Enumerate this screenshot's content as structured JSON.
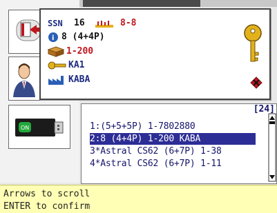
{
  "popup": {
    "type_label": "SSN",
    "count": "16",
    "range_top": "8-8",
    "info_text": "8 (4+4P)",
    "book_text": "1-200",
    "key_text": "KA1",
    "maker_text": "KABA"
  },
  "listbox": {
    "counter": "[24]",
    "items": [
      "1:(5+5+5P) 1-7802880",
      "2:8 (4+4P) 1-200 KABA",
      "3*Astral CS62 (6+7P) 1-38",
      "4*Astral CS62 (6+7P) 1-11"
    ],
    "selected_index": 1
  },
  "status": {
    "line1": "Arrows to scroll",
    "line2": "ENTER to confirm"
  },
  "colors": {
    "selection": "#2d2d96",
    "status_bg": "#ffffb5",
    "accent_red": "#c0161c",
    "key_gold": "#e3b21a"
  }
}
